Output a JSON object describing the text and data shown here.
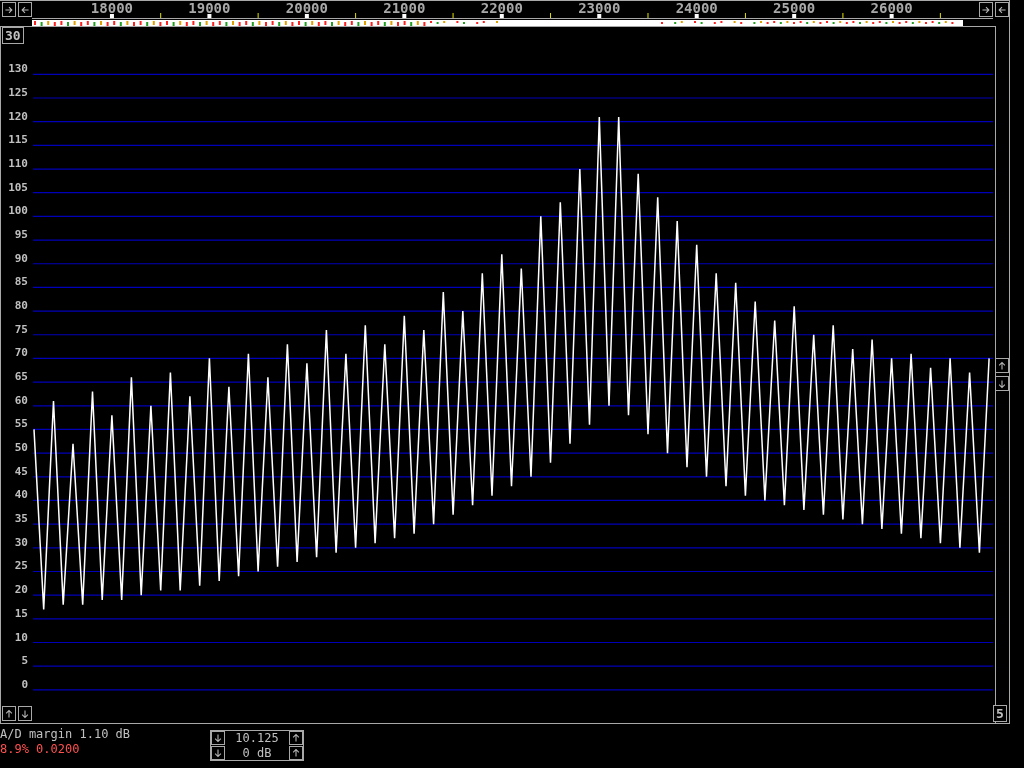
{
  "level_box": {
    "label": "30"
  },
  "spectrum": {
    "chart_data": {
      "type": "line",
      "grid": true,
      "xlim": [
        17190,
        27040
      ],
      "ylim": [
        -7,
        140
      ],
      "xticks": [
        18000,
        19000,
        20000,
        21000,
        22000,
        23000,
        24000,
        25000,
        26000
      ],
      "yticks": [
        0,
        5,
        10,
        15,
        20,
        25,
        30,
        35,
        40,
        45,
        50,
        55,
        60,
        65,
        70,
        75,
        80,
        85,
        90,
        95,
        100,
        105,
        110,
        115,
        120,
        125,
        130
      ],
      "x": [
        17200,
        17300,
        17400,
        17500,
        17600,
        17700,
        17800,
        17900,
        18000,
        18100,
        18200,
        18300,
        18400,
        18500,
        18600,
        18700,
        18800,
        18900,
        19000,
        19100,
        19200,
        19300,
        19400,
        19500,
        19600,
        19700,
        19800,
        19900,
        20000,
        20100,
        20200,
        20300,
        20400,
        20500,
        20600,
        20700,
        20800,
        20900,
        21000,
        21100,
        21200,
        21300,
        21400,
        21500,
        21600,
        21700,
        21800,
        21900,
        22000,
        22100,
        22200,
        22300,
        22400,
        22500,
        22600,
        22700,
        22800,
        22900,
        23000,
        23100,
        23200,
        23300,
        23400,
        23500,
        23600,
        23700,
        23800,
        23900,
        24000,
        24100,
        24200,
        24300,
        24400,
        24500,
        24600,
        24700,
        24800,
        24900,
        25000,
        25100,
        25200,
        25300,
        25400,
        25500,
        25600,
        25700,
        25800,
        25900,
        26000,
        26100,
        26200,
        26300,
        26400,
        26500,
        26600,
        26700,
        26800,
        26900,
        27000
      ],
      "series": [
        {
          "color": "#ffffff",
          "values": [
            55,
            17,
            61,
            18,
            52,
            18,
            63,
            19,
            58,
            19,
            66,
            20,
            60,
            21,
            67,
            21,
            62,
            22,
            70,
            23,
            64,
            24,
            71,
            25,
            66,
            26,
            73,
            27,
            69,
            28,
            76,
            29,
            71,
            30,
            77,
            31,
            73,
            32,
            79,
            33,
            76,
            35,
            84,
            37,
            80,
            39,
            88,
            41,
            92,
            43,
            89,
            45,
            100,
            48,
            103,
            52,
            110,
            56,
            121,
            60,
            121,
            58,
            109,
            54,
            104,
            50,
            99,
            47,
            94,
            45,
            88,
            43,
            86,
            41,
            82,
            40,
            78,
            39,
            81,
            38,
            75,
            37,
            77,
            36,
            72,
            35,
            74,
            34,
            70,
            33,
            71,
            32,
            68,
            31,
            70,
            30,
            67,
            29,
            70
          ]
        }
      ]
    }
  },
  "step_box": {
    "label": "5"
  },
  "status": {
    "ad_margin": "A/D margin 1.10 dB",
    "level_reading": "8.9% 0.0200"
  },
  "gain_controls": [
    {
      "value": "10.125"
    },
    {
      "value": "0 dB"
    }
  ]
}
